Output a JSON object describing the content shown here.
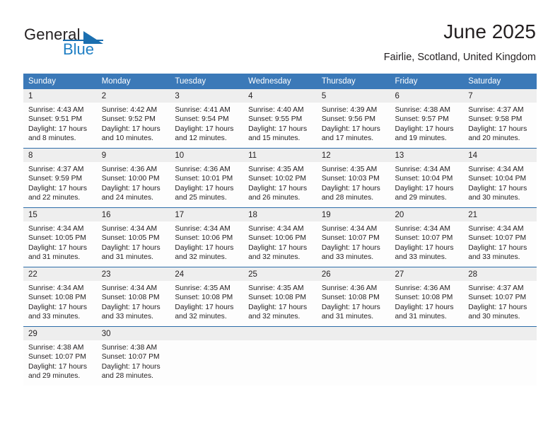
{
  "brand": {
    "line1": "General",
    "line2": "Blue",
    "triangle_color": "#1b6fb0",
    "blue_color": "#1f7fc4",
    "logo_icon": "general-blue-logo"
  },
  "header": {
    "title": "June 2025",
    "subtitle": "Fairlie, Scotland, United Kingdom"
  },
  "calendar": {
    "header_bg": "#3b79b8",
    "header_text_color": "#ffffff",
    "row_divider_color": "#2d6ca8",
    "daynum_band_bg": "#eeeeee",
    "weekdays": [
      "Sunday",
      "Monday",
      "Tuesday",
      "Wednesday",
      "Thursday",
      "Friday",
      "Saturday"
    ],
    "weeks": [
      [
        {
          "day": "1",
          "sunrise": "Sunrise: 4:43 AM",
          "sunset": "Sunset: 9:51 PM",
          "daylight_line1": "Daylight: 17 hours",
          "daylight_line2": "and 8 minutes."
        },
        {
          "day": "2",
          "sunrise": "Sunrise: 4:42 AM",
          "sunset": "Sunset: 9:52 PM",
          "daylight_line1": "Daylight: 17 hours",
          "daylight_line2": "and 10 minutes."
        },
        {
          "day": "3",
          "sunrise": "Sunrise: 4:41 AM",
          "sunset": "Sunset: 9:54 PM",
          "daylight_line1": "Daylight: 17 hours",
          "daylight_line2": "and 12 minutes."
        },
        {
          "day": "4",
          "sunrise": "Sunrise: 4:40 AM",
          "sunset": "Sunset: 9:55 PM",
          "daylight_line1": "Daylight: 17 hours",
          "daylight_line2": "and 15 minutes."
        },
        {
          "day": "5",
          "sunrise": "Sunrise: 4:39 AM",
          "sunset": "Sunset: 9:56 PM",
          "daylight_line1": "Daylight: 17 hours",
          "daylight_line2": "and 17 minutes."
        },
        {
          "day": "6",
          "sunrise": "Sunrise: 4:38 AM",
          "sunset": "Sunset: 9:57 PM",
          "daylight_line1": "Daylight: 17 hours",
          "daylight_line2": "and 19 minutes."
        },
        {
          "day": "7",
          "sunrise": "Sunrise: 4:37 AM",
          "sunset": "Sunset: 9:58 PM",
          "daylight_line1": "Daylight: 17 hours",
          "daylight_line2": "and 20 minutes."
        }
      ],
      [
        {
          "day": "8",
          "sunrise": "Sunrise: 4:37 AM",
          "sunset": "Sunset: 9:59 PM",
          "daylight_line1": "Daylight: 17 hours",
          "daylight_line2": "and 22 minutes."
        },
        {
          "day": "9",
          "sunrise": "Sunrise: 4:36 AM",
          "sunset": "Sunset: 10:00 PM",
          "daylight_line1": "Daylight: 17 hours",
          "daylight_line2": "and 24 minutes."
        },
        {
          "day": "10",
          "sunrise": "Sunrise: 4:36 AM",
          "sunset": "Sunset: 10:01 PM",
          "daylight_line1": "Daylight: 17 hours",
          "daylight_line2": "and 25 minutes."
        },
        {
          "day": "11",
          "sunrise": "Sunrise: 4:35 AM",
          "sunset": "Sunset: 10:02 PM",
          "daylight_line1": "Daylight: 17 hours",
          "daylight_line2": "and 26 minutes."
        },
        {
          "day": "12",
          "sunrise": "Sunrise: 4:35 AM",
          "sunset": "Sunset: 10:03 PM",
          "daylight_line1": "Daylight: 17 hours",
          "daylight_line2": "and 28 minutes."
        },
        {
          "day": "13",
          "sunrise": "Sunrise: 4:34 AM",
          "sunset": "Sunset: 10:04 PM",
          "daylight_line1": "Daylight: 17 hours",
          "daylight_line2": "and 29 minutes."
        },
        {
          "day": "14",
          "sunrise": "Sunrise: 4:34 AM",
          "sunset": "Sunset: 10:04 PM",
          "daylight_line1": "Daylight: 17 hours",
          "daylight_line2": "and 30 minutes."
        }
      ],
      [
        {
          "day": "15",
          "sunrise": "Sunrise: 4:34 AM",
          "sunset": "Sunset: 10:05 PM",
          "daylight_line1": "Daylight: 17 hours",
          "daylight_line2": "and 31 minutes."
        },
        {
          "day": "16",
          "sunrise": "Sunrise: 4:34 AM",
          "sunset": "Sunset: 10:05 PM",
          "daylight_line1": "Daylight: 17 hours",
          "daylight_line2": "and 31 minutes."
        },
        {
          "day": "17",
          "sunrise": "Sunrise: 4:34 AM",
          "sunset": "Sunset: 10:06 PM",
          "daylight_line1": "Daylight: 17 hours",
          "daylight_line2": "and 32 minutes."
        },
        {
          "day": "18",
          "sunrise": "Sunrise: 4:34 AM",
          "sunset": "Sunset: 10:06 PM",
          "daylight_line1": "Daylight: 17 hours",
          "daylight_line2": "and 32 minutes."
        },
        {
          "day": "19",
          "sunrise": "Sunrise: 4:34 AM",
          "sunset": "Sunset: 10:07 PM",
          "daylight_line1": "Daylight: 17 hours",
          "daylight_line2": "and 33 minutes."
        },
        {
          "day": "20",
          "sunrise": "Sunrise: 4:34 AM",
          "sunset": "Sunset: 10:07 PM",
          "daylight_line1": "Daylight: 17 hours",
          "daylight_line2": "and 33 minutes."
        },
        {
          "day": "21",
          "sunrise": "Sunrise: 4:34 AM",
          "sunset": "Sunset: 10:07 PM",
          "daylight_line1": "Daylight: 17 hours",
          "daylight_line2": "and 33 minutes."
        }
      ],
      [
        {
          "day": "22",
          "sunrise": "Sunrise: 4:34 AM",
          "sunset": "Sunset: 10:08 PM",
          "daylight_line1": "Daylight: 17 hours",
          "daylight_line2": "and 33 minutes."
        },
        {
          "day": "23",
          "sunrise": "Sunrise: 4:34 AM",
          "sunset": "Sunset: 10:08 PM",
          "daylight_line1": "Daylight: 17 hours",
          "daylight_line2": "and 33 minutes."
        },
        {
          "day": "24",
          "sunrise": "Sunrise: 4:35 AM",
          "sunset": "Sunset: 10:08 PM",
          "daylight_line1": "Daylight: 17 hours",
          "daylight_line2": "and 32 minutes."
        },
        {
          "day": "25",
          "sunrise": "Sunrise: 4:35 AM",
          "sunset": "Sunset: 10:08 PM",
          "daylight_line1": "Daylight: 17 hours",
          "daylight_line2": "and 32 minutes."
        },
        {
          "day": "26",
          "sunrise": "Sunrise: 4:36 AM",
          "sunset": "Sunset: 10:08 PM",
          "daylight_line1": "Daylight: 17 hours",
          "daylight_line2": "and 31 minutes."
        },
        {
          "day": "27",
          "sunrise": "Sunrise: 4:36 AM",
          "sunset": "Sunset: 10:08 PM",
          "daylight_line1": "Daylight: 17 hours",
          "daylight_line2": "and 31 minutes."
        },
        {
          "day": "28",
          "sunrise": "Sunrise: 4:37 AM",
          "sunset": "Sunset: 10:07 PM",
          "daylight_line1": "Daylight: 17 hours",
          "daylight_line2": "and 30 minutes."
        }
      ],
      [
        {
          "day": "29",
          "sunrise": "Sunrise: 4:38 AM",
          "sunset": "Sunset: 10:07 PM",
          "daylight_line1": "Daylight: 17 hours",
          "daylight_line2": "and 29 minutes."
        },
        {
          "day": "30",
          "sunrise": "Sunrise: 4:38 AM",
          "sunset": "Sunset: 10:07 PM",
          "daylight_line1": "Daylight: 17 hours",
          "daylight_line2": "and 28 minutes."
        },
        {
          "day": "",
          "sunrise": "",
          "sunset": "",
          "daylight_line1": "",
          "daylight_line2": ""
        },
        {
          "day": "",
          "sunrise": "",
          "sunset": "",
          "daylight_line1": "",
          "daylight_line2": ""
        },
        {
          "day": "",
          "sunrise": "",
          "sunset": "",
          "daylight_line1": "",
          "daylight_line2": ""
        },
        {
          "day": "",
          "sunrise": "",
          "sunset": "",
          "daylight_line1": "",
          "daylight_line2": ""
        },
        {
          "day": "",
          "sunrise": "",
          "sunset": "",
          "daylight_line1": "",
          "daylight_line2": ""
        }
      ]
    ]
  }
}
